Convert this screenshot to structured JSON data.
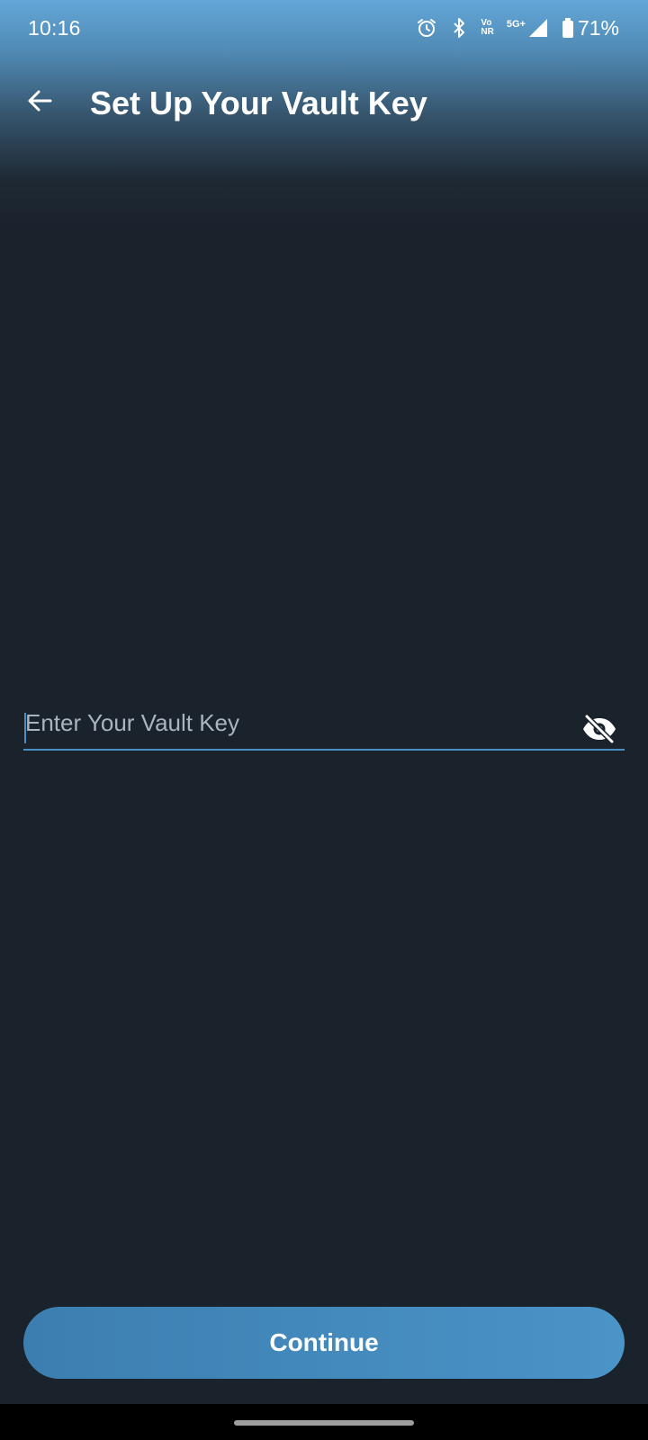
{
  "status_bar": {
    "time": "10:16",
    "network_volte_top": "Vo",
    "network_volte_bottom": "NR",
    "network_type": "5G+",
    "battery_percent": "71%",
    "icons": [
      "alarm-icon",
      "bluetooth-icon",
      "volte-icon",
      "signal-icon",
      "battery-icon"
    ]
  },
  "header": {
    "title": "Set Up Your Vault Key",
    "back_icon": "arrow-left-icon"
  },
  "form": {
    "vault_key_placeholder": "Enter Your Vault Key",
    "vault_key_value": "",
    "visibility_icon": "eye-off-icon"
  },
  "actions": {
    "continue_label": "Continue"
  },
  "colors": {
    "background": "#1a222c",
    "accent": "#4a8fc4",
    "header_gradient_top": "#63a7d8",
    "button_start": "#3d7eb0",
    "button_end": "#4a94c8"
  }
}
